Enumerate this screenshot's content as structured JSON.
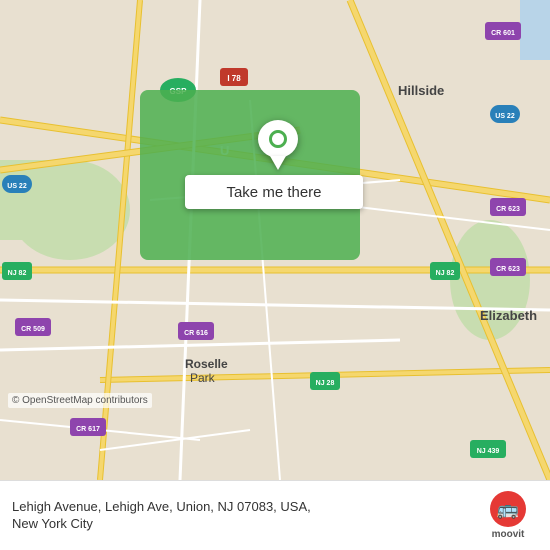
{
  "map": {
    "highlight_color": "#4CAF50",
    "pin_color": "#4CAF50",
    "attribution": "© OpenStreetMap contributors"
  },
  "button": {
    "label": "Take me there"
  },
  "bottom_bar": {
    "address_line1": "Lehigh Avenue, Lehigh Ave, Union, NJ 07083, USA,",
    "address_line2": "New York City"
  },
  "moovit": {
    "logo_text": "moovit",
    "icon": "🚌"
  }
}
